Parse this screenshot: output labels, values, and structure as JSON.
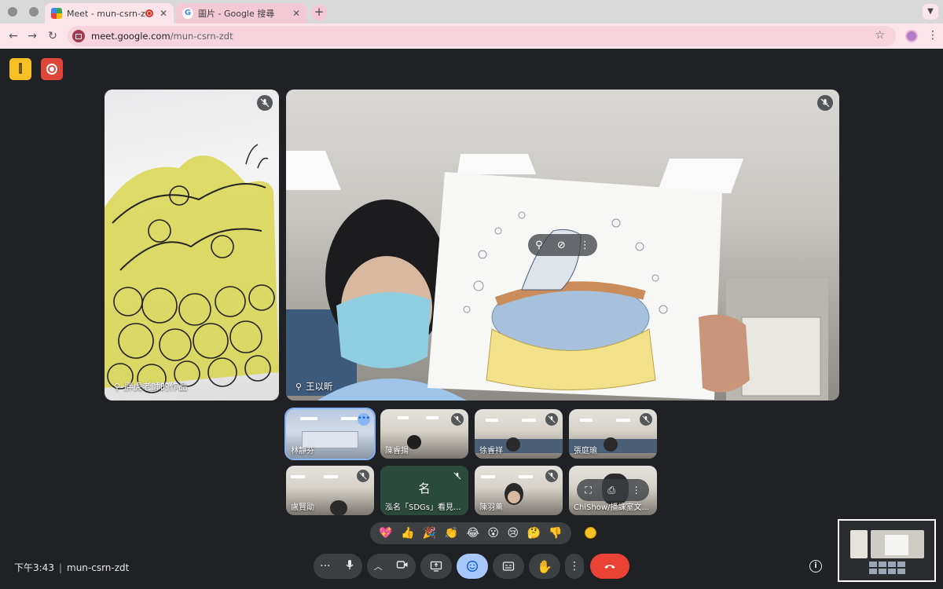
{
  "browser": {
    "tabs": [
      {
        "title": "Meet - mun-csrn-zdt",
        "recording": true
      },
      {
        "title": "圖片 - Google 搜尋"
      }
    ],
    "url_host": "meet.google.com",
    "url_path": "/mun-csrn-zdt"
  },
  "meeting": {
    "time": "下午3:43",
    "code": "mun-csrn-zdt",
    "main_tiles": [
      {
        "name": "胖虎老師的作品"
      },
      {
        "name": "王以昕"
      }
    ],
    "small_tiles": [
      {
        "name": "林靜芬"
      },
      {
        "name": "陳睿揚"
      },
      {
        "name": "徐睿祥"
      },
      {
        "name": "張庭瑜"
      },
      {
        "name": "盧賢勛"
      },
      {
        "name": "泓名「SDGs」看見...",
        "initial": "名"
      },
      {
        "name": "陳羽薰"
      },
      {
        "name": "ChiShow/播課室文..."
      }
    ],
    "reactions": [
      "💖",
      "👍",
      "🎉",
      "👏",
      "😂",
      "😮",
      "😢",
      "🤔",
      "👎"
    ]
  },
  "colors": {
    "meet_bg": "#202124",
    "hangup": "#ea4335",
    "reaction_active": "#a8c7fa",
    "tab_tint": "#fbe4ea"
  }
}
